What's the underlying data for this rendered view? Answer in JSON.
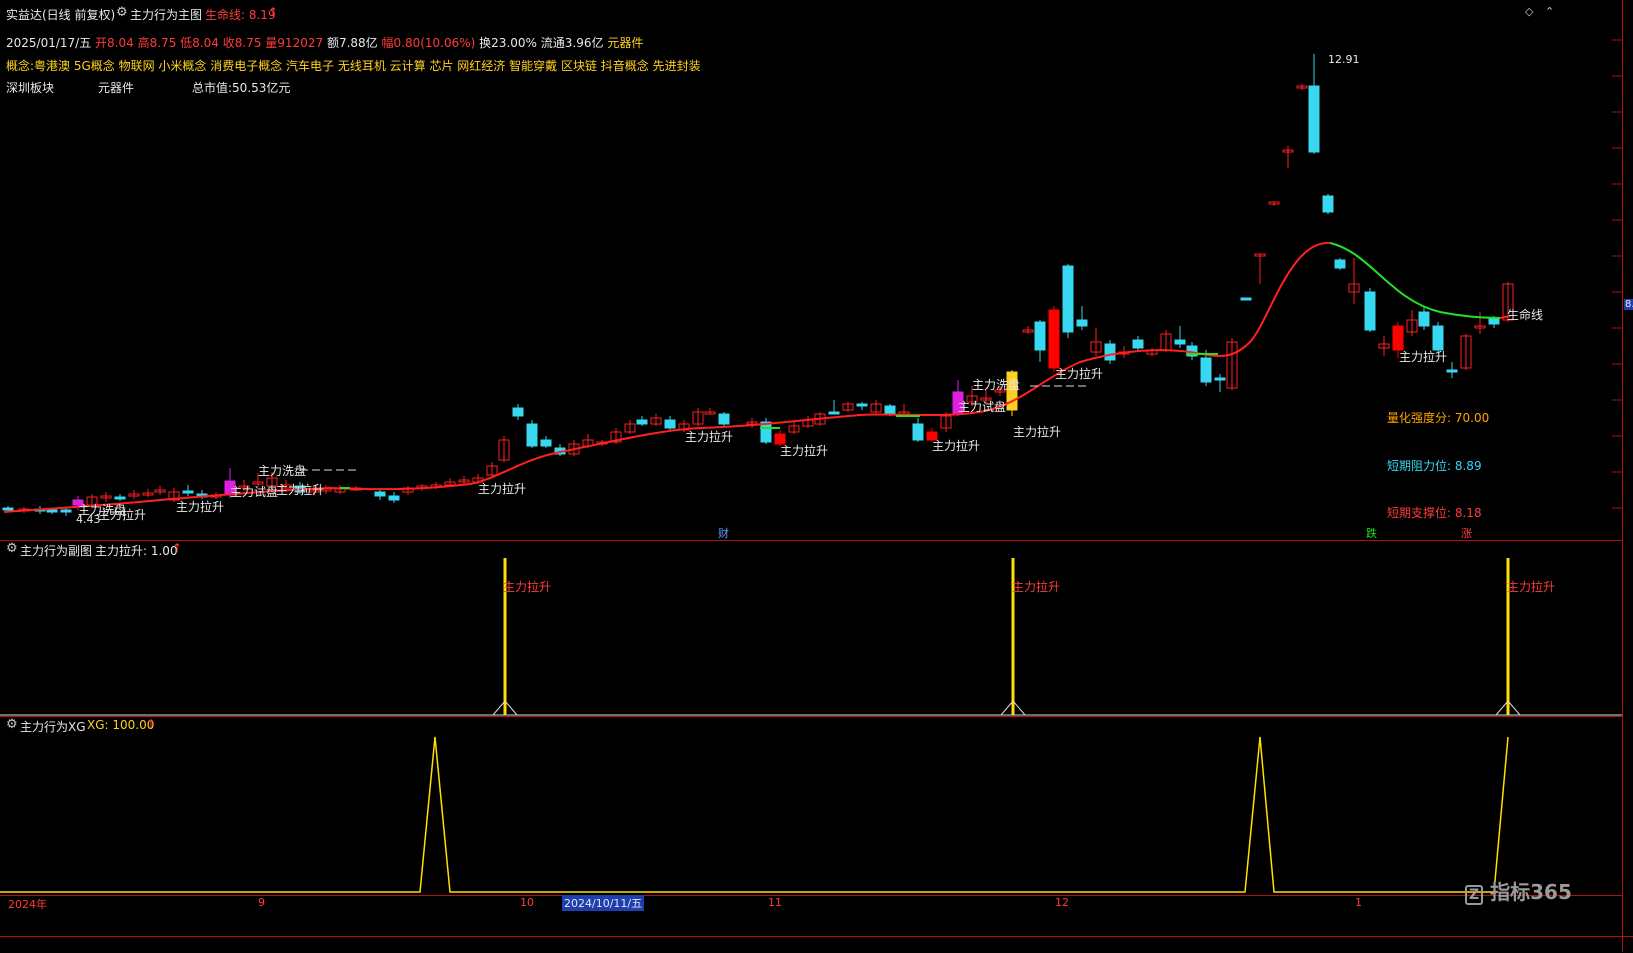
{
  "header": {
    "title": "实益达(日线 前复权)",
    "indicator_name": "主力行为主图",
    "lifeline_label": "生命线: 8.19",
    "arrow": "↑"
  },
  "info": {
    "date": "2025/01/17/五",
    "open": "开8.04",
    "high": "高8.75",
    "low": "低8.04",
    "close": "收8.75",
    "volume": "量912027",
    "amount": "额7.88亿",
    "change": "幅0.80(10.06%)",
    "turnover": "换23.00%",
    "float": "流通3.96亿",
    "industry": "元器件"
  },
  "concepts": "概念:粤港澳 5G概念 物联网 小米概念 消费电子概念 汽车电子 无线耳机 云计算 芯片 网红经济 智能穿戴 区块链 抖音概念 先进封装",
  "board_line": {
    "board": "深圳板块",
    "industry": "元器件",
    "market_cap": "总市值:50.53亿元"
  },
  "price_labels": {
    "high_mark": "12.91",
    "low_mark": "4.43"
  },
  "right_stats": {
    "quant_strength": "量化强度分: 70.00",
    "resistance": "短期阻力位: 8.89",
    "support": "短期支撑位: 8.18"
  },
  "main_labels": {
    "lifeline": "生命线",
    "pull": "主力拉升",
    "test": "主力试盘",
    "wash": "主力洗盘"
  },
  "markers": {
    "cai": "财",
    "die": "跌",
    "zhang": "涨"
  },
  "sub1": {
    "title": "主力行为副图",
    "value": "主力拉升: 1.00",
    "arrow": "↑",
    "bar_label": "主力拉升"
  },
  "sub2": {
    "title": "主力行为XG",
    "value": "XG: 100.00",
    "arrow": "↑"
  },
  "x_axis": {
    "labels": [
      "2024年",
      "9",
      "10",
      "2024/10/11/五",
      "11",
      "12",
      "1"
    ]
  },
  "right_axis": {
    "badge": "8."
  },
  "watermark": "指标365",
  "colors": {
    "up": "#ff2020",
    "down": "#38d8f0",
    "lifeline_up": "#ff2020",
    "lifeline_down": "#22e022",
    "signal": "#ffe000",
    "border": "#b01010"
  }
}
